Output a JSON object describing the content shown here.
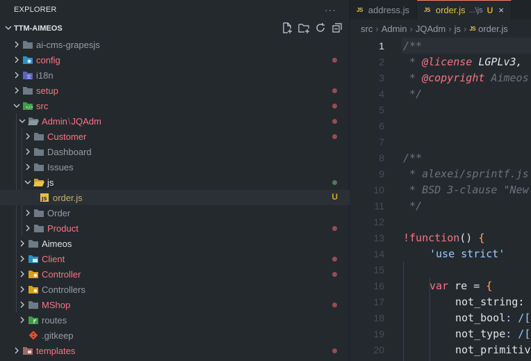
{
  "sidebar": {
    "title": "EXPLORER",
    "more": "···",
    "project": "TTM-AIMEOS",
    "items": [
      {
        "label": "ai-cms-grapesjs",
        "color": "#959da5",
        "dot": "",
        "badge": ""
      },
      {
        "label": "config",
        "color": "#f97583",
        "dot": "#9a4c4c",
        "badge": ""
      },
      {
        "label": "i18n",
        "color": "#959da5",
        "dot": "",
        "badge": ""
      },
      {
        "label": "setup",
        "color": "#f97583",
        "dot": "#9a4c4c",
        "badge": ""
      },
      {
        "label": "src",
        "color": "#f97583",
        "dot": "#9a4c4c",
        "badge": ""
      },
      {
        "label": "Admin",
        "label2": "JQAdm",
        "color": "#f97583",
        "dot": "#9a4c4c",
        "badge": ""
      },
      {
        "label": "Customer",
        "color": "#f97583",
        "dot": "#9a4c4c",
        "badge": ""
      },
      {
        "label": "Dashboard",
        "color": "#959da5",
        "dot": "",
        "badge": ""
      },
      {
        "label": "Issues",
        "color": "#959da5",
        "dot": "",
        "badge": ""
      },
      {
        "label": "js",
        "color": "#e1e4e8",
        "dot": "#4c7a5a",
        "badge": ""
      },
      {
        "label": "order.js",
        "color": "#c4b16a",
        "dot": "",
        "badge": "U"
      },
      {
        "label": "Order",
        "color": "#959da5",
        "dot": "",
        "badge": ""
      },
      {
        "label": "Product",
        "color": "#f97583",
        "dot": "#9a4c4c",
        "badge": ""
      },
      {
        "label": "Aimeos",
        "color": "#e1e4e8",
        "dot": "",
        "badge": ""
      },
      {
        "label": "Client",
        "color": "#f97583",
        "dot": "#9a4c4c",
        "badge": ""
      },
      {
        "label": "Controller",
        "color": "#f97583",
        "dot": "#9a4c4c",
        "badge": ""
      },
      {
        "label": "Controllers",
        "color": "#959da5",
        "dot": "",
        "badge": ""
      },
      {
        "label": "MShop",
        "color": "#f97583",
        "dot": "#9a4c4c",
        "badge": ""
      },
      {
        "label": "routes",
        "color": "#959da5",
        "dot": "",
        "badge": ""
      },
      {
        "label": ".gitkeep",
        "color": "#959da5",
        "dot": "",
        "badge": ""
      },
      {
        "label": "templates",
        "color": "#f97583",
        "dot": "#9a4c4c",
        "badge": ""
      }
    ]
  },
  "tabs": [
    {
      "icon": "JS",
      "label": "address.js"
    },
    {
      "icon": "JS",
      "label": "order.js",
      "path": "...\\js",
      "status": "U",
      "close": "×"
    }
  ],
  "breadcrumb": [
    "src",
    "Admin",
    "JQAdm",
    "js",
    "order.js"
  ],
  "editor": {
    "line_numbers": [
      "1",
      "2",
      "3",
      "4",
      "5",
      "6",
      "7",
      "8",
      "9",
      "10",
      "11",
      "12",
      "13",
      "14",
      "15",
      "16",
      "17",
      "18",
      "19",
      "20"
    ],
    "code": {
      "l1": "/**",
      "l2a": " * ",
      "l2b": "@license",
      "l2c": " LGPLv3,",
      "l3a": " * ",
      "l3b": "@copyright",
      "l3c": " Aimeos",
      "l4": " */",
      "l8": "/**",
      "l9": " * alexei/sprintf.js",
      "l10": " * BSD 3-clause \"New",
      "l11": " */",
      "l13a": "!",
      "l13b": "function",
      "l13c": "() ",
      "l13d": "{",
      "l14": "'use strict'",
      "l16a": "var",
      "l16b": " re = ",
      "l16c": "{",
      "l17a": "not_string",
      "l17b": ": ",
      "l18a": "not_bool",
      "l18b": ": /[",
      "l19a": "not_type",
      "l19b": ": /[",
      "l20a": "not_primitiv"
    }
  }
}
